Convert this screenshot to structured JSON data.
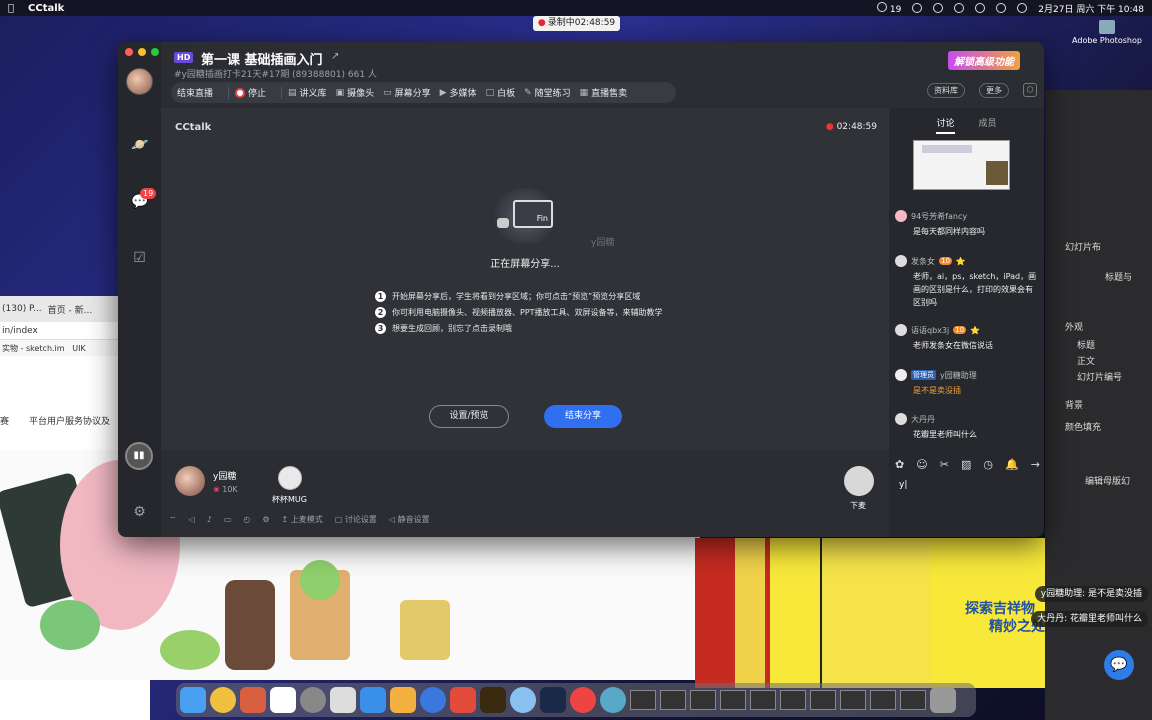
{
  "menubar": {
    "app": "CCtalk",
    "items_right": [
      "19",
      "2月27日 周六 下午 10:48"
    ]
  },
  "recording": {
    "label": "录制中02:48:59"
  },
  "desktop_icons": [
    "Adobe Photoshop"
  ],
  "window": {
    "hd": "HD",
    "title": "第一课 基础插画入门",
    "subinfo": "#y园糖插画打卡21天#17期 (89388801)   661 人",
    "upgrade": "解锁高级功能",
    "toolbar": {
      "end_live": "结束直播",
      "stop": "停止",
      "items": [
        "讲义库",
        "摄像头",
        "屏幕分享",
        "多媒体",
        "白板",
        "随堂练习",
        "直播售卖"
      ]
    },
    "header_buttons": {
      "library": "资料库",
      "more": "更多"
    },
    "stage": {
      "brand": "CCtalk",
      "timer": "02:48:59",
      "monitor_label": "Fin",
      "ghost_name": "y园糖",
      "sharing": "正在屏幕分享...",
      "steps": [
        "开始屏幕分享后，学生将看到分享区域；你可点击“预览”预览分享区域",
        "你可利用电脑摄像头、视频播放器、PPT播放工具、双屏设备等，来辅助教学",
        "想要生成回顾，别忘了点击录制哦"
      ],
      "btn_preview": "设置/预览",
      "btn_end": "结束分享"
    },
    "bottom": {
      "host_name": "y园糖",
      "host_fans": "10K",
      "guest_name": "杯杯MUG",
      "stage_down": "下麦",
      "tools": [
        "上麦模式",
        "讨论设置",
        "静音设置"
      ]
    },
    "side": {
      "tabs": [
        "讨论",
        "成员"
      ],
      "messages": [
        {
          "who": "94号芳希fancy",
          "text": "是每天都同样内容吗"
        },
        {
          "who": "发条女",
          "level": "10",
          "text": "老师，ai，ps，sketch，iPad，画画的区别是什么，打印的效果会有区别吗"
        },
        {
          "who": "语语qbx3j",
          "level": "10",
          "text": "老师发条女在微信说话"
        },
        {
          "who": "y园糖助理",
          "tag": "管理员",
          "text": "是不是卖没插"
        },
        {
          "who": "大丹丹",
          "text": "花瓣里老师叫什么"
        }
      ],
      "input_value": "y|"
    },
    "left_badge": "19"
  },
  "background": {
    "browser_tabs": [
      "(130) P...",
      "首页 - 新..."
    ],
    "browser_url": "in/index",
    "browser_bookmarks": [
      "实物 - sketch.im",
      "UIK"
    ],
    "browser_links": [
      "赛",
      "平台用户服务协议及"
    ],
    "right_panel": [
      "幻灯片布",
      "标题与",
      "外观",
      "标题",
      "正文",
      "幻灯片编号",
      "背景",
      "颜色填充",
      "编辑母版幻"
    ],
    "yellow_title_1": "探索吉祥物",
    "yellow_title_2": "精妙之处",
    "notifications": [
      "y园糖助理: 是不是卖没插",
      "大丹丹: 花瓣里老师叫什么"
    ]
  },
  "colors": {
    "accent": "#2f6ff0",
    "window_bg": "#2b2d33",
    "stage_bg": "#303238"
  }
}
